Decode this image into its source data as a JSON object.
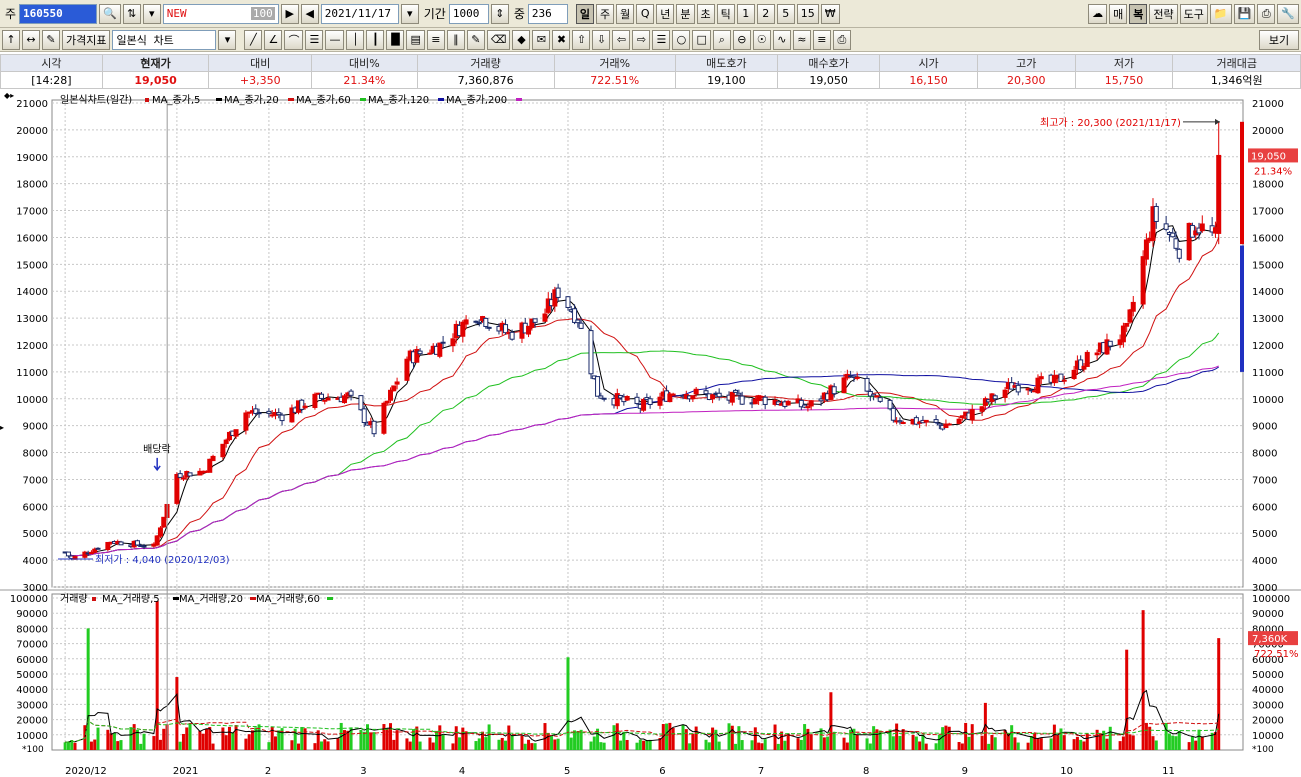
{
  "toolbar1": {
    "market_label": "주",
    "stock_code": "160550",
    "type_value": "NEW",
    "type_count": "100",
    "date_value": "2021/11/17",
    "period_label": "기간",
    "period_value": "1000",
    "count_label": "중",
    "count_value": "236",
    "intervals": [
      "일",
      "주",
      "월",
      "Q",
      "년",
      "분",
      "초",
      "틱",
      "1",
      "2",
      "5",
      "15",
      "₩"
    ],
    "right_buttons": [
      "매",
      "복",
      "전략",
      "도구"
    ]
  },
  "toolbar2": {
    "indicator_button": "가격지표",
    "chart_type_value": "일본식 차트",
    "view_button": "보기"
  },
  "quote": {
    "headers": [
      "시각",
      "현재가",
      "대비",
      "대비%",
      "거래량",
      "거래%",
      "매도호가",
      "매수호가",
      "시가",
      "고가",
      "저가",
      "거래대금"
    ],
    "values": [
      "[14:28]",
      "19,050",
      "+3,350",
      "21.34%",
      "7,360,876",
      "722.51%",
      "19,100",
      "19,050",
      "16,150",
      "20,300",
      "15,750",
      "1,346억원"
    ]
  },
  "chart_data": {
    "type": "candlestick",
    "price_panel": {
      "title": "일본식차트(일간)",
      "ma_legend": [
        "MA_종가,5",
        "MA_종가,20",
        "MA_종가,60",
        "MA_종가,120",
        "MA_종가,200"
      ],
      "ma_colors": [
        "#d01010",
        "#000000",
        "#d01010",
        "#20c020",
        "#1010a0",
        "#c020c0"
      ],
      "y_ticks": [
        3000,
        4000,
        5000,
        6000,
        7000,
        8000,
        9000,
        10000,
        11000,
        12000,
        13000,
        14000,
        15000,
        16000,
        17000,
        18000,
        19000,
        20000,
        21000
      ],
      "ylim": [
        3000,
        21000
      ],
      "high_annotation": "최고가 : 20,300 (2021/11/17)",
      "low_annotation": "최저가 : 4,040 (2020/12/03)",
      "event_annotation": "배당락",
      "current_price_label": "19,050",
      "current_change_label": "21.34%",
      "day_range": [
        15750,
        20300
      ],
      "volume_profile_range": [
        11000,
        15700
      ]
    },
    "volume_panel": {
      "title": "거래량",
      "ma_legend": [
        "MA_거래량,5",
        "MA_거래량,20",
        "MA_거래량,60"
      ],
      "y_ticks": [
        10000,
        20000,
        30000,
        40000,
        50000,
        60000,
        70000,
        80000,
        90000,
        100000
      ],
      "ylim": [
        0,
        100000
      ],
      "unit_label": "*100",
      "current_volume_label": "7,360K",
      "current_volume_pct": "722.51%"
    },
    "x_labels": [
      "2020/12",
      "2021",
      "2",
      "3",
      "4",
      "5",
      "6",
      "7",
      "8",
      "9",
      "10",
      "11"
    ],
    "trend_points": [
      [
        "2020-12-01",
        4300
      ],
      [
        "2020-12-03",
        4040
      ],
      [
        "2020-12-15",
        4700
      ],
      [
        "2020-12-28",
        4500
      ],
      [
        "2021-01-04",
        7200
      ],
      [
        "2021-01-12",
        7300
      ],
      [
        "2021-01-25",
        9500
      ],
      [
        "2021-02-05",
        9400
      ],
      [
        "2021-02-15",
        10000
      ],
      [
        "2021-02-25",
        10100
      ],
      [
        "2021-03-05",
        8800
      ],
      [
        "2021-03-15",
        11500
      ],
      [
        "2021-03-25",
        12000
      ],
      [
        "2021-04-05",
        13200
      ],
      [
        "2021-04-15",
        12400
      ],
      [
        "2021-04-25",
        13000
      ],
      [
        "2021-04-30",
        14000
      ],
      [
        "2021-05-06",
        13000
      ],
      [
        "2021-05-12",
        10200
      ],
      [
        "2021-05-25",
        9700
      ],
      [
        "2021-06-05",
        10300
      ],
      [
        "2021-06-20",
        10000
      ],
      [
        "2021-07-01",
        10000
      ],
      [
        "2021-07-15",
        9700
      ],
      [
        "2021-07-28",
        10800
      ],
      [
        "2021-08-10",
        9300
      ],
      [
        "2021-08-25",
        9000
      ],
      [
        "2021-09-02",
        9400
      ],
      [
        "2021-09-15",
        10500
      ],
      [
        "2021-09-28",
        10600
      ],
      [
        "2021-10-08",
        11500
      ],
      [
        "2021-10-20",
        12500
      ],
      [
        "2021-10-28",
        16800
      ],
      [
        "2021-11-01",
        16300
      ],
      [
        "2021-11-05",
        15600
      ],
      [
        "2021-11-10",
        16500
      ],
      [
        "2021-11-16",
        16000
      ],
      [
        "2021-11-17",
        19050
      ]
    ],
    "volume_spikes": [
      [
        "2020-12-08",
        80000
      ],
      [
        "2020-12-29",
        98000
      ],
      [
        "2021-01-04",
        48000
      ],
      [
        "2021-05-03",
        61000
      ],
      [
        "2021-07-22",
        38000
      ],
      [
        "2021-09-07",
        31000
      ],
      [
        "2021-10-20",
        66000
      ],
      [
        "2021-10-25",
        92000
      ],
      [
        "2021-11-17",
        73600
      ]
    ]
  }
}
